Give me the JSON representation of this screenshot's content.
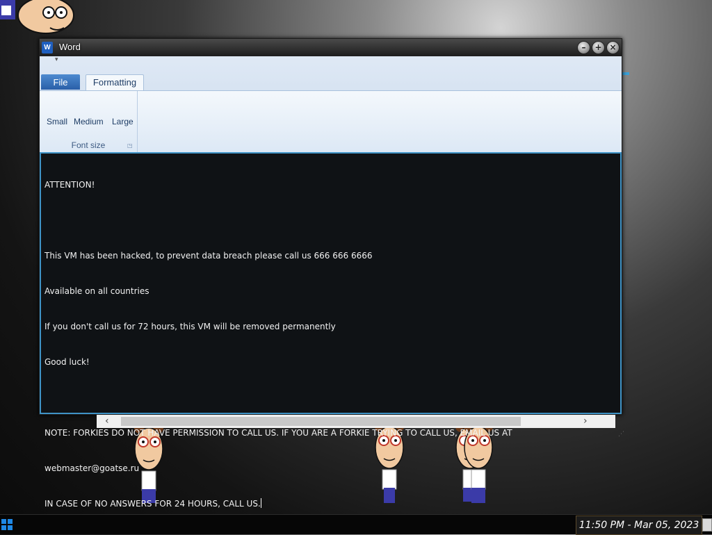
{
  "window": {
    "app_icon_letter": "W",
    "title": "Word",
    "controls": {
      "minimize": "–",
      "maximize": "+",
      "close": "×"
    }
  },
  "ribbon": {
    "quick_access_glyph": "▾",
    "tabs": [
      {
        "label": "File"
      },
      {
        "label": "Formatting"
      }
    ],
    "font_size_group": {
      "buttons": [
        "Small",
        "Medium",
        "Large"
      ],
      "label": "Font size",
      "launcher_glyph": "◳"
    }
  },
  "document": {
    "lines": [
      "ATTENTION!",
      "",
      "This VM has been hacked, to prevent data breach please call us 666 666 6666",
      "Available on all countries",
      "If you don't call us for 72 hours, this VM will be removed permanently",
      "Good luck!",
      "",
      "NOTE: FORKIES DO NOT HAVE PERMISSION TO CALL US. IF YOU ARE A FORKIE TRYING TO CALL US, EMAIL US AT",
      "webmaster@goatse.ru",
      "IN CASE OF NO ANSWERS FOR 24 HOURS, CALL US."
    ]
  },
  "scrollbar": {
    "left_arrow": "‹",
    "right_arrow": "›"
  },
  "taskbar": {
    "clock": "11:50 PM - Mar 05, 2023"
  },
  "colors": {
    "editor_bg": "#0f1215",
    "editor_border": "#3f93c6",
    "ribbon_bg": "#dfe9f5",
    "file_tab": "#2a5fa8",
    "taskbar_bg": "#060606"
  }
}
